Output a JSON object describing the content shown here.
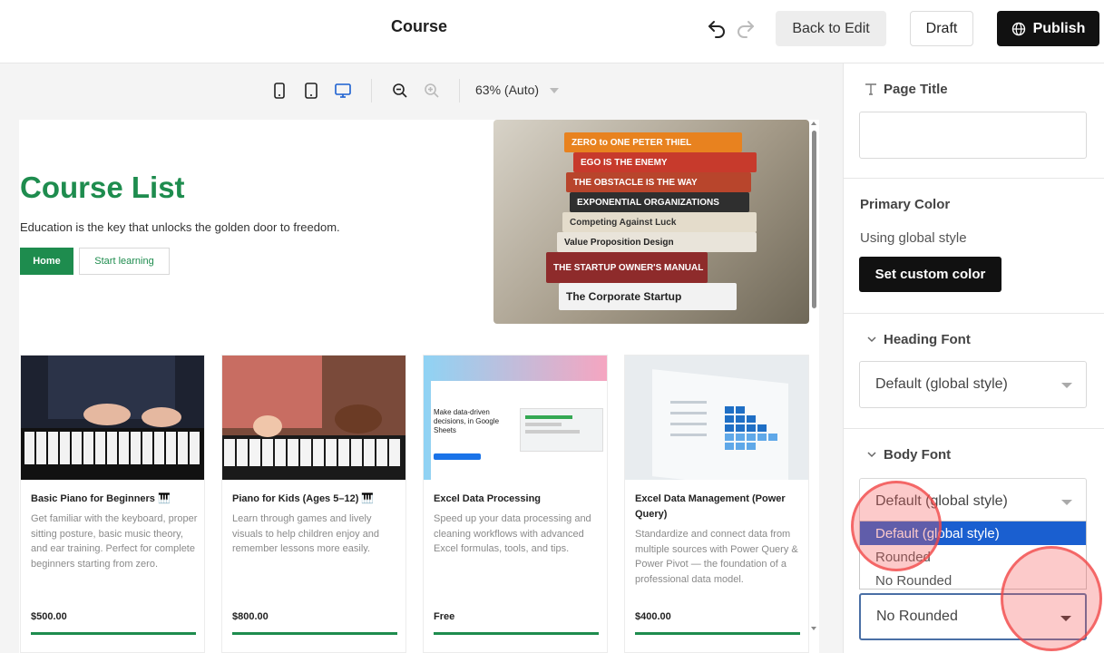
{
  "header": {
    "title": "Course",
    "back_to_edit": "Back to Edit",
    "draft": "Draft",
    "publish": "Publish"
  },
  "toolbar": {
    "zoom": "63% (Auto)"
  },
  "preview": {
    "hero": {
      "title": "Course List",
      "subtitle": "Education is the key that unlocks the golden door to freedom.",
      "home_button": "Home",
      "start_button": "Start learning",
      "books": [
        "ZERO to ONE   PETER THIEL",
        "EGO IS THE ENEMY",
        "THE OBSTACLE IS THE WAY",
        "EXPONENTIAL ORGANIZATIONS",
        "Competing Against Luck",
        "Value Proposition Design",
        "THE STARTUP OWNER'S MANUAL",
        "The Corporate Startup"
      ]
    },
    "cards": [
      {
        "title": "Basic Piano for Beginners 🎹",
        "description": "Get familiar with the keyboard, proper sitting posture, basic music theory, and ear training. Perfect for complete beginners starting from zero.",
        "price": "$500.00"
      },
      {
        "title": "Piano for Kids (Ages 5–12) 🎹",
        "description": "Learn through games and lively visuals to help children enjoy and remember lessons more easily.",
        "price": "$800.00"
      },
      {
        "title": "Excel Data Processing",
        "description": "Speed up your data processing and cleaning workflows with advanced Excel formulas, tools, and tips.",
        "price": "Free",
        "image_text": "Make data-driven decisions, in Google Sheets"
      },
      {
        "title": "Excel Data Management (Power Query)",
        "description": "Standardize and connect data from multiple sources with Power Query & Power Pivot — the foundation of a professional data model.",
        "price": "$400.00"
      }
    ]
  },
  "panel": {
    "page_title": {
      "label": "Page Title",
      "value": ""
    },
    "primary_color": {
      "label": "Primary Color",
      "status": "Using global style",
      "button": "Set custom color"
    },
    "heading_font": {
      "label": "Heading Font",
      "value": "Default (global style)"
    },
    "body_font": {
      "label": "Body Font",
      "value": "Default (global style)",
      "options": [
        "Default (global style)",
        "Rounded",
        "No Rounded"
      ]
    },
    "rounded_select": {
      "value": "No Rounded"
    }
  },
  "colors": {
    "accent_green": "#1e8c4e",
    "selected_blue": "#1a5fd0",
    "publish_bg": "#111111"
  }
}
